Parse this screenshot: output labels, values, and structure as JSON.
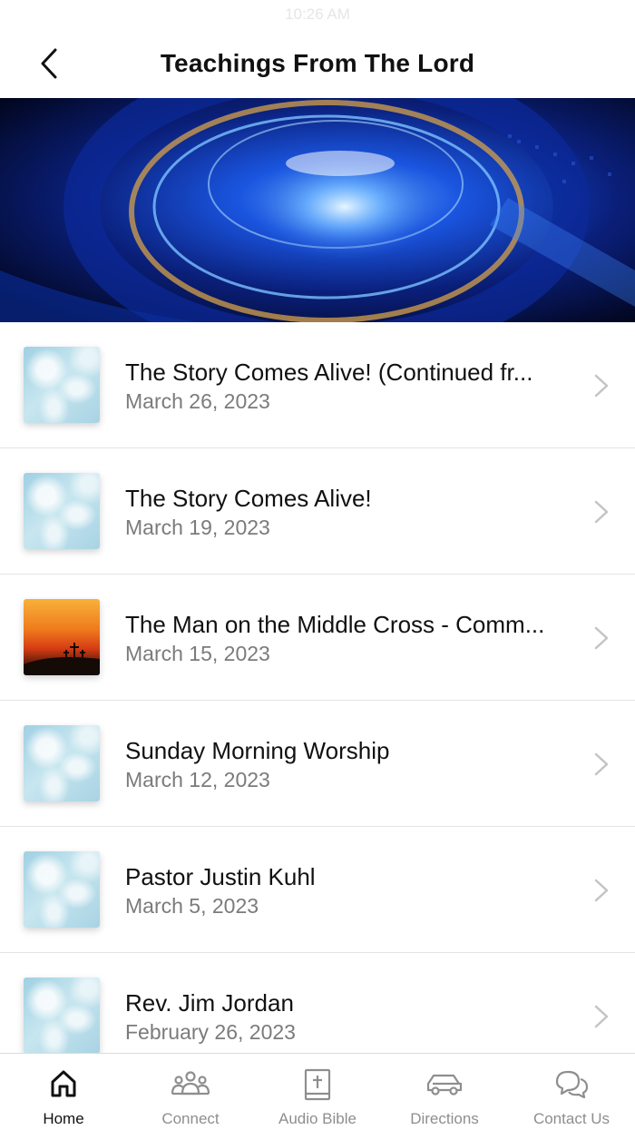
{
  "status_bar": {
    "time": "10:26 AM"
  },
  "header": {
    "title": "Teachings From The Lord"
  },
  "items": [
    {
      "title": "The Story Comes Alive!  (Continued fr...",
      "date": "March 26, 2023",
      "thumb": "clouds"
    },
    {
      "title": "The Story Comes Alive!",
      "date": "March 19, 2023",
      "thumb": "clouds"
    },
    {
      "title": "The Man on the Middle Cross - Comm...",
      "date": "March 15, 2023",
      "thumb": "sunset"
    },
    {
      "title": "Sunday Morning Worship",
      "date": "March 12, 2023",
      "thumb": "clouds"
    },
    {
      "title": "Pastor Justin Kuhl",
      "date": "March 5, 2023",
      "thumb": "clouds"
    },
    {
      "title": "Rev. Jim Jordan",
      "date": "February 26, 2023",
      "thumb": "clouds"
    }
  ],
  "tabs": [
    {
      "label": "Home",
      "icon": "home-icon",
      "active": true
    },
    {
      "label": "Connect",
      "icon": "people-icon",
      "active": false
    },
    {
      "label": "Audio Bible",
      "icon": "bible-icon",
      "active": false
    },
    {
      "label": "Directions",
      "icon": "car-icon",
      "active": false
    },
    {
      "label": "Contact Us",
      "icon": "chat-bubbles-icon",
      "active": false
    }
  ],
  "colors": {
    "active_tab": "#111111",
    "inactive_tab": "#8e8e8e",
    "date_text": "#7b7b7b",
    "banner_accent": "#1e6bff"
  }
}
